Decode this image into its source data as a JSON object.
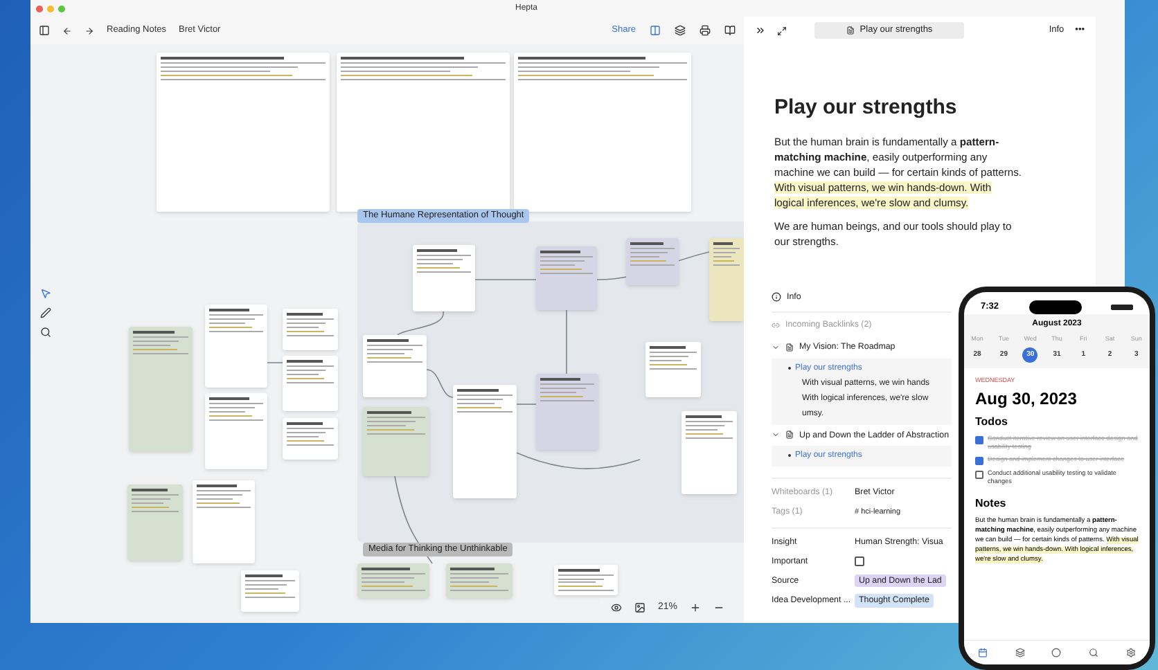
{
  "window": {
    "title": "Hepta"
  },
  "toolbar": {
    "breadcrumbs": [
      "Reading Notes",
      "Bret Victor"
    ],
    "share": "Share"
  },
  "canvas": {
    "group_labels": [
      {
        "text": "The Humane Representation of Thought",
        "color": "#a9c6ee"
      },
      {
        "text": "Media for Thinking the Unthinkable",
        "color": "#b9b9b9"
      }
    ],
    "zoom": "21%"
  },
  "panel": {
    "tab_title": "Play our strengths",
    "info_button": "Info",
    "more": "•••",
    "heading": "Play our strengths",
    "paragraphs": [
      [
        {
          "text": "But the human brain is fundamentally a **pattern-matching machine**, easily outperforming any machine we can build — for certain kinds of patterns. ",
          "highlight": false
        },
        {
          "text": "With visual patterns, we win hands-down. With logical inferences, we're slow and clumsy.",
          "highlight": true
        }
      ],
      [
        {
          "text": "We are human beings, and our tools should play to our strengths.",
          "highlight": false
        }
      ]
    ],
    "info_title": "Info",
    "backlinks_title": "Incoming Backlinks (2)",
    "backlinks": [
      {
        "title": "My Vision: The Roadmap",
        "expanded": true,
        "link": "Play our strengths",
        "lines": [
          "With visual patterns, we win hands",
          "With logical inferences, we're slow",
          "umsy."
        ]
      },
      {
        "title": "Up and Down the Ladder of Abstraction",
        "expanded": true,
        "link": "Play our strengths"
      }
    ],
    "whiteboards": {
      "label": "Whiteboards (1)",
      "value": "Bret Victor"
    },
    "tags": {
      "label": "Tags (1)",
      "value": "# hci-learning"
    },
    "properties": [
      {
        "kind": "text",
        "label": "Insight",
        "value": "Human Strength: Visua"
      },
      {
        "kind": "checkbox",
        "label": "Important",
        "checked": false
      },
      {
        "kind": "pill",
        "label": "Source",
        "value": "Up and Down the Lad",
        "color": "#ddd3f5"
      },
      {
        "kind": "pill",
        "label": "Idea Development ...",
        "value": "Thought Complete",
        "color": "#d3e3f7"
      }
    ]
  },
  "phone": {
    "time": "7:32",
    "month": "August 2023",
    "days": [
      {
        "name": "Mon",
        "date": "28",
        "selected": false
      },
      {
        "name": "Tue",
        "date": "29",
        "selected": false
      },
      {
        "name": "Wed",
        "date": "30",
        "selected": true
      },
      {
        "name": "Thu",
        "date": "31",
        "selected": false
      },
      {
        "name": "Fri",
        "date": "1",
        "selected": false
      },
      {
        "name": "Sat",
        "date": "2",
        "selected": false
      },
      {
        "name": "Sun",
        "date": "3",
        "selected": false
      }
    ],
    "weekday": "WEDNESDAY",
    "date": "Aug 30, 2023",
    "todos_title": "Todos",
    "todos": [
      {
        "text": "Conduct iterative review on user interface design and usability testing",
        "checked": true
      },
      {
        "text": "Design and implement changes to user interface",
        "checked": true
      },
      {
        "text": "Conduct additional usability testing to validate changes",
        "checked": false
      }
    ],
    "notes_title": "Notes",
    "notes": [
      {
        "text": "But the human brain is fundamentally a **pattern-matching machine**, easily outperforming any machine we can build — for certain kinds of patterns. ",
        "highlight": false
      },
      {
        "text": "With visual patterns, we win hands-down. With logical inferences, we're slow and clumsy.",
        "highlight": true
      }
    ]
  }
}
